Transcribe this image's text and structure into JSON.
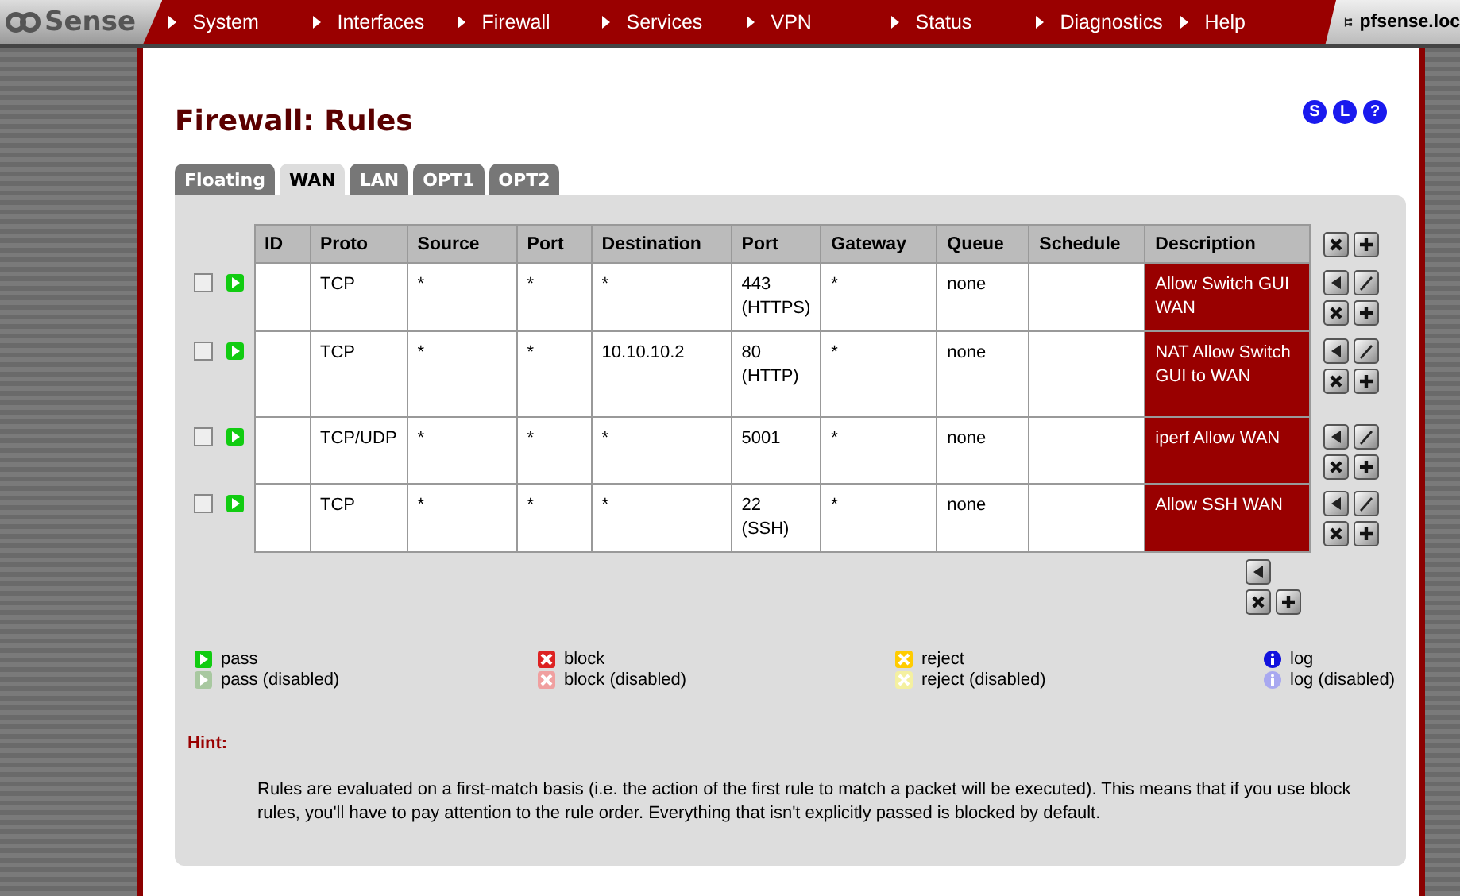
{
  "header": {
    "logo": "Sense",
    "menu": [
      "System",
      "Interfaces",
      "Firewall",
      "Services",
      "VPN",
      "Status",
      "Diagnostics",
      "Help"
    ],
    "hostname": "pfsense.loc"
  },
  "page": {
    "title": "Firewall: Rules",
    "help_buttons": [
      "S",
      "L",
      "?"
    ]
  },
  "tabs": [
    {
      "label": "Floating",
      "selected": false
    },
    {
      "label": "WAN",
      "selected": true
    },
    {
      "label": "LAN",
      "selected": false
    },
    {
      "label": "OPT1",
      "selected": false
    },
    {
      "label": "OPT2",
      "selected": false
    }
  ],
  "table": {
    "columns": [
      "ID",
      "Proto",
      "Source",
      "Port",
      "Destination",
      "Port",
      "Gateway",
      "Queue",
      "Schedule",
      "Description"
    ],
    "rows": [
      {
        "checked": false,
        "kind": "pass",
        "disabled": false,
        "cells": [
          "",
          "TCP",
          "*",
          "*",
          "*",
          "443 (HTTPS)",
          "*",
          "none",
          "",
          "Allow Switch GUI WAN"
        ]
      },
      {
        "checked": false,
        "kind": "pass",
        "disabled": false,
        "cells": [
          "",
          "TCP",
          "*",
          "*",
          "10.10.10.2",
          "80 (HTTP)",
          "*",
          "none",
          "",
          "NAT Allow Switch GUI to WAN"
        ]
      },
      {
        "checked": false,
        "kind": "pass",
        "disabled": false,
        "cells": [
          "",
          "TCP/UDP",
          "*",
          "*",
          "*",
          "5001",
          "*",
          "none",
          "",
          "iperf Allow WAN"
        ]
      },
      {
        "checked": false,
        "kind": "pass",
        "disabled": false,
        "cells": [
          "",
          "TCP",
          "*",
          "*",
          "*",
          "22 (SSH)",
          "*",
          "none",
          "",
          "Allow SSH WAN"
        ]
      }
    ]
  },
  "legend": [
    {
      "label": "pass",
      "kind": "pass",
      "disabled": false
    },
    {
      "label": "pass (disabled)",
      "kind": "pass",
      "disabled": true
    },
    {
      "label": "block",
      "kind": "block",
      "disabled": false
    },
    {
      "label": "block (disabled)",
      "kind": "block",
      "disabled": true
    },
    {
      "label": "reject",
      "kind": "reject",
      "disabled": false
    },
    {
      "label": "reject (disabled)",
      "kind": "reject",
      "disabled": true
    },
    {
      "label": "log",
      "kind": "log",
      "disabled": false
    },
    {
      "label": "log (disabled)",
      "kind": "log",
      "disabled": true
    }
  ],
  "hint": {
    "label": "Hint:",
    "text": "Rules are evaluated on a first-match basis (i.e. the action of the first rule to match a packet will be executed). This means that if you use block rules, you'll have to pay attention to the rule order. Everything that isn't explicitly passed is blocked by default."
  }
}
